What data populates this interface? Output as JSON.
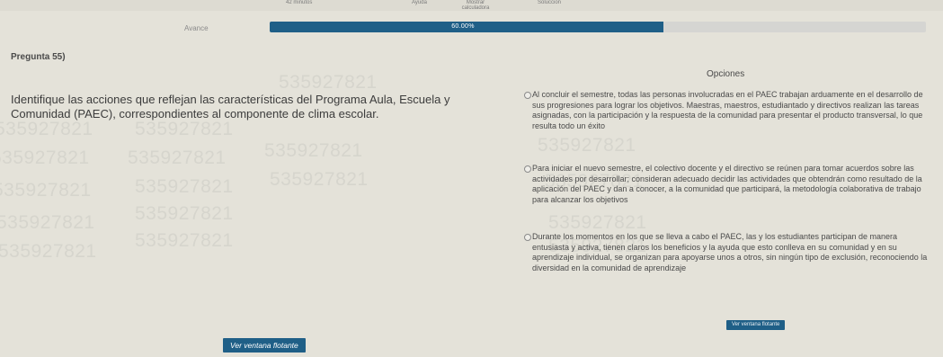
{
  "header": {
    "items": [
      "42 minutos",
      "Ayuda",
      "Mostrar calculadora",
      "Soluccion"
    ]
  },
  "progress": {
    "label": "Avance",
    "value_text": "60.00%",
    "value": 0.6,
    "color": "#1f5f87"
  },
  "question": {
    "number": "Pregunta 55)",
    "text": "Identifique las acciones que reflejan las características del Programa Aula, Escuela y Comunidad (PAEC), correspondientes al componente de clima escolar."
  },
  "options": {
    "title": "Opciones",
    "items": [
      "Al concluir el semestre, todas las personas involucradas en el PAEC trabajan arduamente en el desarrollo de sus progresiones para lograr los objetivos. Maestras, maestros, estudiantado y directivos realizan las tareas asignadas, con la participación y la respuesta de la comunidad para presentar el producto transversal, lo que resulta todo un éxito",
      "Para iniciar el nuevo semestre, el colectivo docente y el directivo se reúnen para tomar acuerdos sobre las actividades por desarrollar; consideran adecuado decidir las actividades que obtendrán como resultado de la aplicación del PAEC y dan a conocer, a la comunidad que participará, la metodología colaborativa de trabajo para alcanzar los objetivos",
      "Durante los momentos en los que se lleva a cabo el PAEC, las y los estudiantes participan de manera entusiasta y activa, tienen claros los beneficios y la ayuda que esto conlleva en su comunidad y en su aprendizaje individual, se organizan para apoyarse unos a otros, sin ningún tipo de exclusión, reconociendo la diversidad en la comunidad de aprendizaje"
    ]
  },
  "watermark": "535927821",
  "buttons": {
    "floating_window": "Ver ventana flotante",
    "floating_window_small": "Ver ventana flotante"
  }
}
